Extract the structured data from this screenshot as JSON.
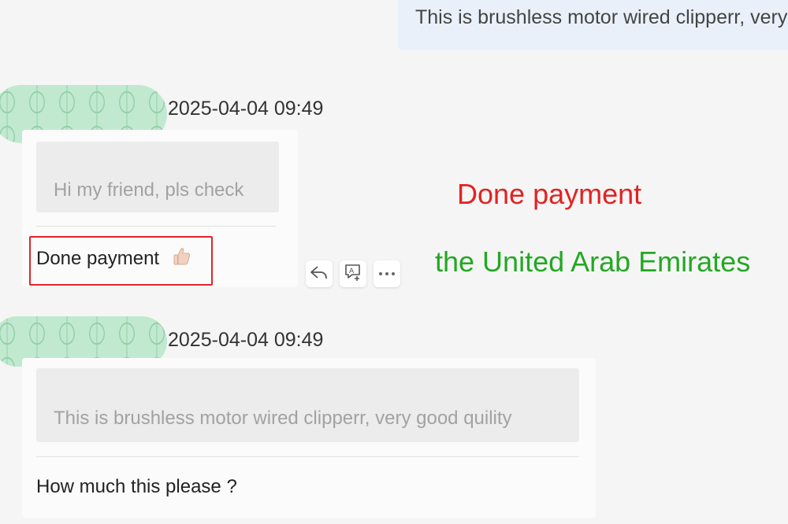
{
  "top_outgoing": {
    "text": "This is brushless motor wired clipperr, very good quility"
  },
  "messages": [
    {
      "timestamp": "2025-04-04 09:49",
      "quote": "Hi my friend, pls check",
      "text": "Done payment"
    },
    {
      "timestamp": "2025-04-04 09:49",
      "quote": "This is brushless motor wired clipperr, very good quility",
      "text": "How much this please ?"
    }
  ],
  "actions": [
    {
      "icon": "reply-icon"
    },
    {
      "icon": "translate-icon"
    },
    {
      "icon": "more-icon"
    }
  ],
  "annotations": {
    "payment_note": "Done payment",
    "country_note": "the United Arab Emirates"
  },
  "colors": {
    "annotation_red": "#e32222",
    "annotation_green": "#23a823",
    "highlight_border": "#e0242b"
  }
}
